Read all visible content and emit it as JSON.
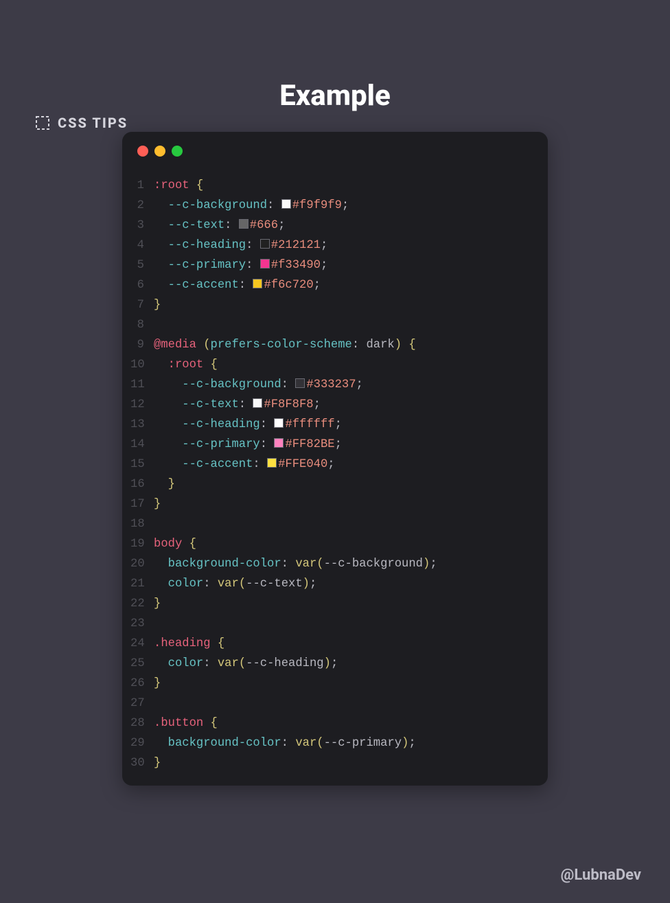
{
  "header": {
    "label": "CSS TIPS"
  },
  "title": "Example",
  "footer": "@LubnaDev",
  "colors": {
    "bg": "#f9f9f9",
    "text": "#666",
    "heading": "#212121",
    "primary": "#f33490",
    "accent": "#f6c720",
    "d_bg": "#333237",
    "d_text": "#F8F8F8",
    "d_heading": "#ffffff",
    "d_primary": "#FF82BE",
    "d_accent": "#FFE040"
  },
  "code": {
    "lines": [
      [
        {
          "c": "t-sel",
          "t": ":root"
        },
        {
          "c": "t-punc",
          "t": " "
        },
        {
          "c": "t-paren",
          "t": "{"
        }
      ],
      [
        {
          "c": "t-punc",
          "t": "  "
        },
        {
          "c": "t-prop",
          "t": "--c-background"
        },
        {
          "c": "t-punc",
          "t": ": "
        },
        {
          "sw": "bg"
        },
        {
          "c": "t-val",
          "t": "#f9f9f9"
        },
        {
          "c": "t-punc",
          "t": ";"
        }
      ],
      [
        {
          "c": "t-punc",
          "t": "  "
        },
        {
          "c": "t-prop",
          "t": "--c-text"
        },
        {
          "c": "t-punc",
          "t": ": "
        },
        {
          "sw": "text"
        },
        {
          "c": "t-val",
          "t": "#666"
        },
        {
          "c": "t-punc",
          "t": ";"
        }
      ],
      [
        {
          "c": "t-punc",
          "t": "  "
        },
        {
          "c": "t-prop",
          "t": "--c-heading"
        },
        {
          "c": "t-punc",
          "t": ": "
        },
        {
          "sw": "heading"
        },
        {
          "c": "t-val",
          "t": "#212121"
        },
        {
          "c": "t-punc",
          "t": ";"
        }
      ],
      [
        {
          "c": "t-punc",
          "t": "  "
        },
        {
          "c": "t-prop",
          "t": "--c-primary"
        },
        {
          "c": "t-punc",
          "t": ": "
        },
        {
          "sw": "primary"
        },
        {
          "c": "t-val",
          "t": "#f33490"
        },
        {
          "c": "t-punc",
          "t": ";"
        }
      ],
      [
        {
          "c": "t-punc",
          "t": "  "
        },
        {
          "c": "t-prop",
          "t": "--c-accent"
        },
        {
          "c": "t-punc",
          "t": ": "
        },
        {
          "sw": "accent"
        },
        {
          "c": "t-val",
          "t": "#f6c720"
        },
        {
          "c": "t-punc",
          "t": ";"
        }
      ],
      [
        {
          "c": "t-paren",
          "t": "}"
        }
      ],
      [],
      [
        {
          "c": "t-sel",
          "t": "@media"
        },
        {
          "c": "t-punc",
          "t": " "
        },
        {
          "c": "t-paren",
          "t": "("
        },
        {
          "c": "t-prop",
          "t": "prefers-color-scheme"
        },
        {
          "c": "t-punc",
          "t": ": dark"
        },
        {
          "c": "t-paren",
          "t": ")"
        },
        {
          "c": "t-punc",
          "t": " "
        },
        {
          "c": "t-paren",
          "t": "{"
        }
      ],
      [
        {
          "c": "t-punc",
          "t": "  "
        },
        {
          "c": "t-sel",
          "t": ":root"
        },
        {
          "c": "t-punc",
          "t": " "
        },
        {
          "c": "t-paren",
          "t": "{"
        }
      ],
      [
        {
          "c": "t-punc",
          "t": "    "
        },
        {
          "c": "t-prop",
          "t": "--c-background"
        },
        {
          "c": "t-punc",
          "t": ": "
        },
        {
          "sw": "d_bg"
        },
        {
          "c": "t-val",
          "t": "#333237"
        },
        {
          "c": "t-punc",
          "t": ";"
        }
      ],
      [
        {
          "c": "t-punc",
          "t": "    "
        },
        {
          "c": "t-prop",
          "t": "--c-text"
        },
        {
          "c": "t-punc",
          "t": ": "
        },
        {
          "sw": "d_text"
        },
        {
          "c": "t-val",
          "t": "#F8F8F8"
        },
        {
          "c": "t-punc",
          "t": ";"
        }
      ],
      [
        {
          "c": "t-punc",
          "t": "    "
        },
        {
          "c": "t-prop",
          "t": "--c-heading"
        },
        {
          "c": "t-punc",
          "t": ": "
        },
        {
          "sw": "d_heading"
        },
        {
          "c": "t-val",
          "t": "#ffffff"
        },
        {
          "c": "t-punc",
          "t": ";"
        }
      ],
      [
        {
          "c": "t-punc",
          "t": "    "
        },
        {
          "c": "t-prop",
          "t": "--c-primary"
        },
        {
          "c": "t-punc",
          "t": ": "
        },
        {
          "sw": "d_primary"
        },
        {
          "c": "t-val",
          "t": "#FF82BE"
        },
        {
          "c": "t-punc",
          "t": ";"
        }
      ],
      [
        {
          "c": "t-punc",
          "t": "    "
        },
        {
          "c": "t-prop",
          "t": "--c-accent"
        },
        {
          "c": "t-punc",
          "t": ": "
        },
        {
          "sw": "d_accent"
        },
        {
          "c": "t-val",
          "t": "#FFE040"
        },
        {
          "c": "t-punc",
          "t": ";"
        }
      ],
      [
        {
          "c": "t-punc",
          "t": "  "
        },
        {
          "c": "t-paren",
          "t": "}"
        }
      ],
      [
        {
          "c": "t-paren",
          "t": "}"
        }
      ],
      [],
      [
        {
          "c": "t-sel",
          "t": "body"
        },
        {
          "c": "t-punc",
          "t": " "
        },
        {
          "c": "t-paren",
          "t": "{"
        }
      ],
      [
        {
          "c": "t-punc",
          "t": "  "
        },
        {
          "c": "t-prop",
          "t": "background-color"
        },
        {
          "c": "t-punc",
          "t": ": "
        },
        {
          "c": "t-var",
          "t": "var"
        },
        {
          "c": "t-paren",
          "t": "("
        },
        {
          "c": "t-punc",
          "t": "--c-background"
        },
        {
          "c": "t-paren",
          "t": ")"
        },
        {
          "c": "t-punc",
          "t": ";"
        }
      ],
      [
        {
          "c": "t-punc",
          "t": "  "
        },
        {
          "c": "t-prop",
          "t": "color"
        },
        {
          "c": "t-punc",
          "t": ": "
        },
        {
          "c": "t-var",
          "t": "var"
        },
        {
          "c": "t-paren",
          "t": "("
        },
        {
          "c": "t-punc",
          "t": "--c-text"
        },
        {
          "c": "t-paren",
          "t": ")"
        },
        {
          "c": "t-punc",
          "t": ";"
        }
      ],
      [
        {
          "c": "t-paren",
          "t": "}"
        }
      ],
      [],
      [
        {
          "c": "t-sel",
          "t": ".heading"
        },
        {
          "c": "t-punc",
          "t": " "
        },
        {
          "c": "t-paren",
          "t": "{"
        }
      ],
      [
        {
          "c": "t-punc",
          "t": "  "
        },
        {
          "c": "t-prop",
          "t": "color"
        },
        {
          "c": "t-punc",
          "t": ": "
        },
        {
          "c": "t-var",
          "t": "var"
        },
        {
          "c": "t-paren",
          "t": "("
        },
        {
          "c": "t-punc",
          "t": "--c-heading"
        },
        {
          "c": "t-paren",
          "t": ")"
        },
        {
          "c": "t-punc",
          "t": ";"
        }
      ],
      [
        {
          "c": "t-paren",
          "t": "}"
        }
      ],
      [],
      [
        {
          "c": "t-sel",
          "t": ".button"
        },
        {
          "c": "t-punc",
          "t": " "
        },
        {
          "c": "t-paren",
          "t": "{"
        }
      ],
      [
        {
          "c": "t-punc",
          "t": "  "
        },
        {
          "c": "t-prop",
          "t": "background-color"
        },
        {
          "c": "t-punc",
          "t": ": "
        },
        {
          "c": "t-var",
          "t": "var"
        },
        {
          "c": "t-paren",
          "t": "("
        },
        {
          "c": "t-punc",
          "t": "--c-primary"
        },
        {
          "c": "t-paren",
          "t": ")"
        },
        {
          "c": "t-punc",
          "t": ";"
        }
      ],
      [
        {
          "c": "t-paren",
          "t": "}"
        }
      ]
    ]
  }
}
